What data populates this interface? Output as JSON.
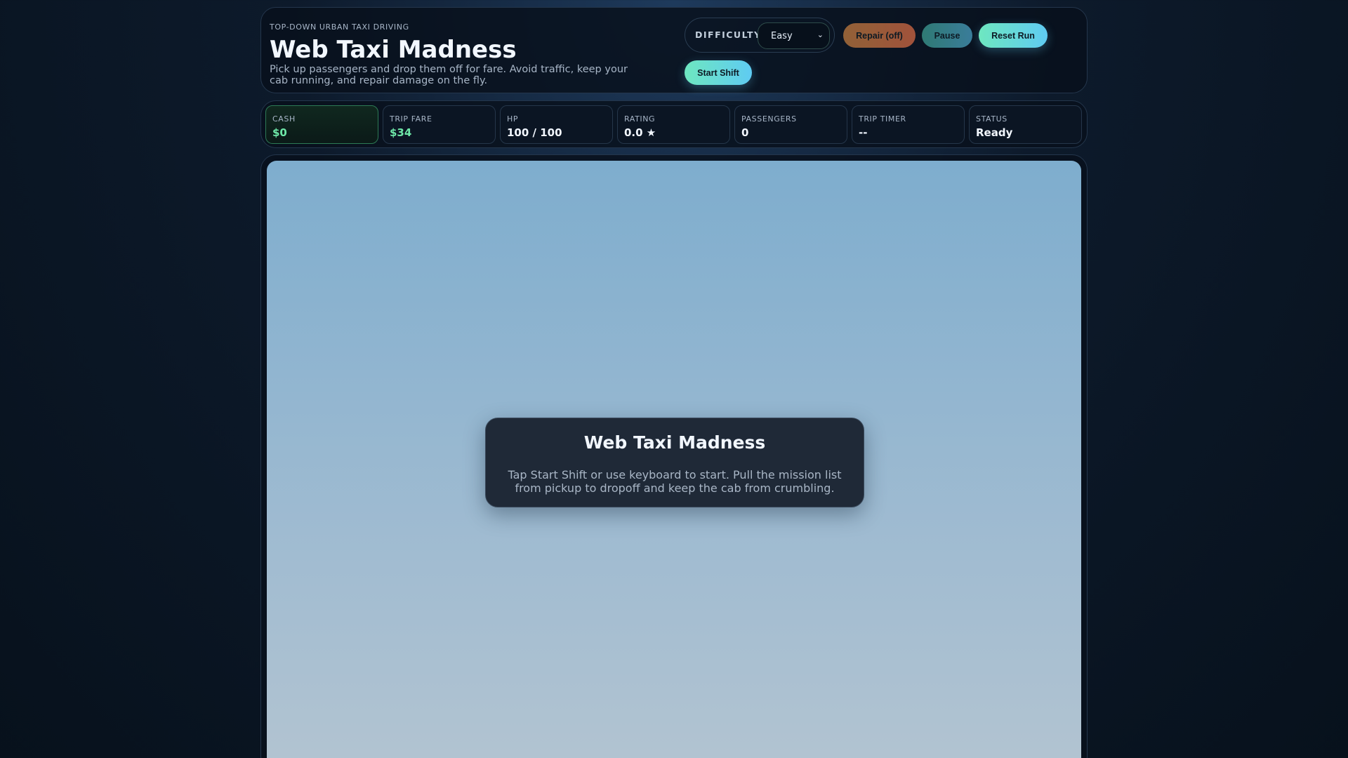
{
  "header": {
    "kicker": "TOP-DOWN URBAN TAXI DRIVING",
    "title": "Web Taxi Madness",
    "subtitle": "Pick up passengers and drop them off for fare. Avoid traffic, keep your cab running, and repair damage on the fly."
  },
  "controls": {
    "difficulty_label": "DIFFICULTY",
    "difficulty_value": "Easy",
    "chevron": "⌄",
    "repair": "Repair (off)",
    "pause": "Pause",
    "reset": "Reset Run",
    "start": "Start Shift"
  },
  "stats": [
    {
      "label": "CASH",
      "value": "$0"
    },
    {
      "label": "TRIP FARE",
      "value": "$34"
    },
    {
      "label": "HP",
      "value": "100 / 100"
    },
    {
      "label": "RATING",
      "value": "0.0 ★"
    },
    {
      "label": "PASSENGERS",
      "value": "0"
    },
    {
      "label": "TRIP TIMER",
      "value": "--"
    },
    {
      "label": "STATUS",
      "value": "Ready"
    }
  ],
  "overlay": {
    "title": "Web Taxi Madness",
    "text": "Tap Start Shift or use keyboard to start. Pull the mission list from pickup to dropoff and keep the cab from crumbling."
  }
}
